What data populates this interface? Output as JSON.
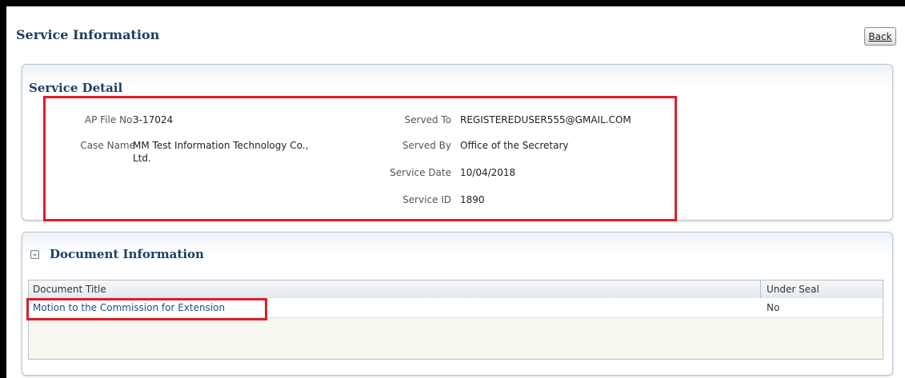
{
  "page": {
    "title": "Service Information",
    "back_label": "Back"
  },
  "service_detail": {
    "title": "Service Detail",
    "fields_left": [
      {
        "label": "AP File No.",
        "value": "3-17024"
      },
      {
        "label": "Case Name",
        "value": "MM Test Information Technology Co.,",
        "value_line2": "Ltd."
      }
    ],
    "fields_right": [
      {
        "label": "Served To",
        "value": "REGISTEREDUSER555@GMAIL.COM"
      },
      {
        "label": "Served By",
        "value": "Office of the Secretary"
      },
      {
        "label": "Service Date",
        "value": "10/04/2018"
      },
      {
        "label": "Service ID",
        "value": "1890"
      }
    ]
  },
  "document_info": {
    "title": "Document Information",
    "disclose_icon": "chevron-down-icon",
    "columns": [
      "Document Title",
      "Under Seal"
    ],
    "rows": [
      {
        "title": "Motion to the Commission for Extension",
        "under_seal": "No"
      }
    ]
  },
  "colors": {
    "highlight": "#e01b2a",
    "title": "#1d3f62",
    "link": "#1a4e8a"
  }
}
